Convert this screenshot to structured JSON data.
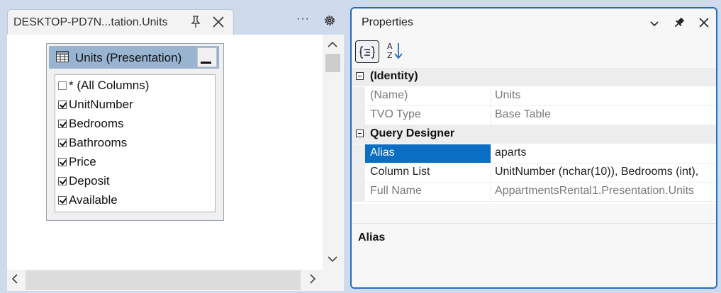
{
  "left_window": {
    "tab_title": "DESKTOP-PD7N...tation.Units",
    "more_label": "···",
    "table": {
      "title": "Units (Presentation)",
      "columns": [
        {
          "label": "* (All Columns)",
          "checked": false
        },
        {
          "label": "UnitNumber",
          "checked": true
        },
        {
          "label": "Bedrooms",
          "checked": true
        },
        {
          "label": "Bathrooms",
          "checked": true
        },
        {
          "label": "Price",
          "checked": true
        },
        {
          "label": "Deposit",
          "checked": true
        },
        {
          "label": "Available",
          "checked": true
        }
      ]
    }
  },
  "properties": {
    "title": "Properties",
    "toolbar": {
      "categorized_icon": "categorized-icon",
      "alphabetical_icon": "sort-alphabetical-icon"
    },
    "categories": [
      {
        "label": "(Identity)",
        "rows": [
          {
            "name": "(Name)",
            "value": "Units",
            "readonly": true,
            "selected": false
          },
          {
            "name": "TVO Type",
            "value": "Base Table",
            "readonly": true,
            "selected": false
          }
        ]
      },
      {
        "label": "Query Designer",
        "rows": [
          {
            "name": "Alias",
            "value": "aparts",
            "readonly": false,
            "selected": true
          },
          {
            "name": "Column List",
            "value": "UnitNumber (nchar(10)), Bedrooms (int),",
            "readonly": false,
            "selected": false
          },
          {
            "name": "Full Name",
            "value": "AppartmentsRental1.Presentation.Units",
            "readonly": true,
            "selected": false
          }
        ]
      }
    ],
    "description_title": "Alias"
  },
  "colors": {
    "accent": "#1f6fc4",
    "selection": "#0a6ec4",
    "table_header": "#99b4d1"
  }
}
